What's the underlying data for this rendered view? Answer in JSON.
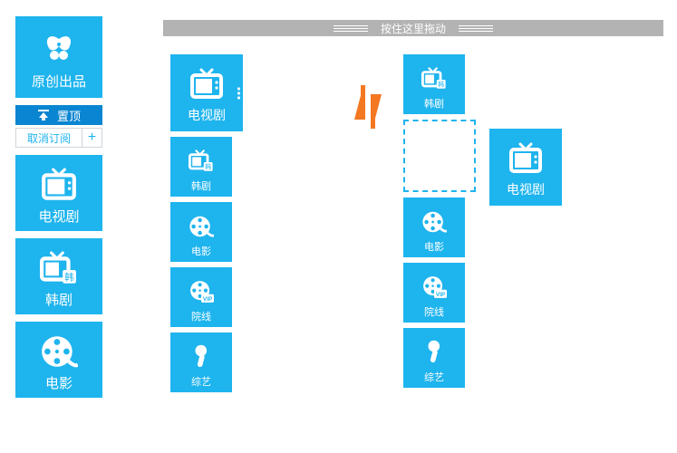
{
  "sidebar": {
    "original_label": "原创出品",
    "pin_label": "置顶",
    "cancel_label": "取消订阅",
    "add_label": "+",
    "items": [
      {
        "label": "电视剧",
        "icon": "tv-icon"
      },
      {
        "label": "韩剧",
        "icon": "korean-tv-icon"
      },
      {
        "label": "电影",
        "icon": "film-reel-icon"
      }
    ]
  },
  "drag_bar_label": "按住这里拖动",
  "swap_icon": "swap-icon",
  "left_column": {
    "big": {
      "label": "电视剧",
      "icon": "tv-icon"
    },
    "items": [
      {
        "label": "韩剧",
        "icon": "korean-tv-icon"
      },
      {
        "label": "电影",
        "icon": "film-reel-icon"
      },
      {
        "label": "院线",
        "icon": "vip-reel-icon"
      },
      {
        "label": "综艺",
        "icon": "mic-icon"
      }
    ]
  },
  "right_column": {
    "top": {
      "label": "韩剧",
      "icon": "korean-tv-icon"
    },
    "items": [
      {
        "label": "电影",
        "icon": "film-reel-icon"
      },
      {
        "label": "院线",
        "icon": "vip-reel-icon"
      },
      {
        "label": "综艺",
        "icon": "mic-icon"
      }
    ]
  },
  "floating_tile": {
    "label": "电视剧",
    "icon": "tv-icon"
  },
  "colors": {
    "accent": "#1eb4ee",
    "bar": "#b3b3b3",
    "swap": "#f47722"
  }
}
